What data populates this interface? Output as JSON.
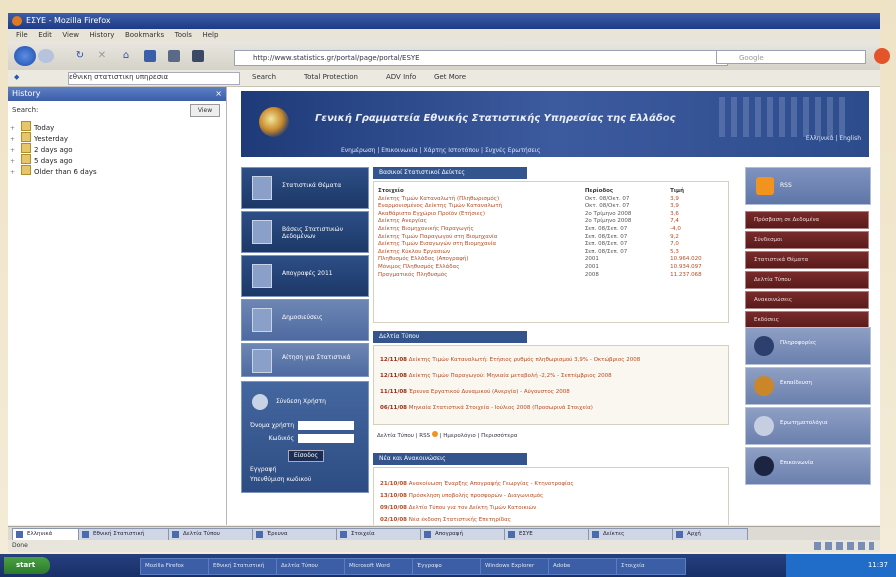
{
  "browser": {
    "title": "ΕΣΥΕ - Mozilla Firefox",
    "menu": [
      "File",
      "Edit",
      "View",
      "History",
      "Bookmarks",
      "Tools",
      "Help"
    ],
    "url": "http://www.statistics.gr/portal/page/portal/ESYE",
    "search_placeholder": "Google",
    "toolbar2": {
      "select_value": "εθνικη στατιστικη υπηρεσια",
      "search_label": "Search",
      "total_protection": "Total Protection",
      "adv_info": "ADV Info",
      "get_more": "Get More"
    }
  },
  "sidebar": {
    "title": "History",
    "search_label": "Search:",
    "view_label": "View",
    "items": [
      "Today",
      "Yesterday",
      "2 days ago",
      "5 days ago",
      "Older than 6 days"
    ]
  },
  "banner": {
    "title": "Γενική Γραμματεία Εθνικής Στατιστικής Υπηρεσίας της Ελλάδος",
    "subtitle": "Ενημέρωση | Επικοινωνία | Χάρτης Ιστοτόπου | Συχνές Ερωτήσεις",
    "right_links": "Ελληνικά | English"
  },
  "left_nav": [
    {
      "label": "Στατιστικά Θέματα"
    },
    {
      "label": "Βάσεις Στατιστικών Δεδομένων"
    },
    {
      "label": "Απογραφές 2011"
    },
    {
      "label": "Δημοσιεύσεις"
    },
    {
      "label": "Αίτηση για Στατιστικά"
    }
  ],
  "login": {
    "title": "Σύνδεση Χρήστη",
    "username_label": "Όνομα χρήστη",
    "password_label": "Κωδικός",
    "submit_label": "Είσοδος",
    "register_link": "Εγγραφή",
    "forgot_link": "Υπενθύμιση κωδικού"
  },
  "panels": {
    "indicators_title": "Βασικοί Στατιστικοί Δείκτες",
    "news_title": "Δελτία Τύπου",
    "announcements_title": "Νέα και Ανακοινώσεις",
    "news_links": [
      "Δελτία Τύπου",
      "RSS",
      "Ημερολόγιο",
      "Περισσότερα"
    ]
  },
  "stats_table": {
    "headers": [
      "Στοιχείο",
      "Περίοδος",
      "Τιμή"
    ],
    "rows": [
      [
        "Δείκτης Τιμών Καταναλωτή (Πληθωρισμός)",
        "Οκτ. 08/Οκτ. 07",
        "3,9"
      ],
      [
        "Εναρμονισμένος Δείκτης Τιμών Καταναλωτή",
        "Οκτ. 08/Οκτ. 07",
        "3,9"
      ],
      [
        "Ακαθάριστο Εγχώριο Προϊόν (Ετήσιες)",
        "2ο Τρίμηνο 2008",
        "3,6"
      ],
      [
        "Δείκτης Ανεργίας",
        "2ο Τρίμηνο 2008",
        "7,4"
      ],
      [
        "Δείκτης Βιομηχανικής Παραγωγής",
        "Σεπ. 08/Σεπ. 07",
        "-4,0"
      ],
      [
        "Δείκτης Τιμών Παραγωγού στη Βιομηχανία",
        "Σεπ. 08/Σεπ. 07",
        "9,2"
      ],
      [
        "Δείκτης Τιμών Εισαγωγών στη Βιομηχανία",
        "Σεπ. 08/Σεπ. 07",
        "7,0"
      ],
      [
        "Δείκτης Κύκλου Εργασιών",
        "Σεπ. 08/Σεπ. 07",
        "5,3"
      ],
      [
        "Πληθυσμός Ελλάδας (Απογραφή)",
        "2001",
        "10.964.020"
      ],
      [
        "Μόνιμος Πληθυσμός Ελλάδας",
        "2001",
        "10.934.097"
      ],
      [
        "Πραγματικός Πληθυσμός",
        "2008",
        "11.237.068"
      ]
    ]
  },
  "news": [
    {
      "date": "12/11/08",
      "text": "Δείκτης Τιμών Καταναλωτή: Ετήσιος ρυθμός πληθωρισμού 3,9% - Οκτώβριος 2008"
    },
    {
      "date": "12/11/08",
      "text": "Δείκτης Τιμών Παραγωγού: Μηνιαία μεταβολή -2,2% - Σεπτέμβριος 2008"
    },
    {
      "date": "11/11/08",
      "text": "Έρευνα Εργατικού Δυναμικού (Ανεργία) - Αύγουστος 2008"
    },
    {
      "date": "06/11/08",
      "text": "Μηνιαία Στατιστικά Στοιχεία - Ιούλιος 2008 (Προσωρινά Στοιχεία)"
    }
  ],
  "announcements": [
    {
      "date": "21/10/08",
      "text": "Ανακοίνωση Έναρξης Απογραφής Γεωργίας - Κτηνοτροφίας"
    },
    {
      "date": "13/10/08",
      "text": "Πρόσκληση υποβολής προσφορών - Διαγωνισμός"
    },
    {
      "date": "09/10/08",
      "text": "Δελτίο Τύπου για τον Δείκτη Τιμών Κατοικιών"
    },
    {
      "date": "02/10/08",
      "text": "Νέα έκδοση Στατιστικής Επετηρίδας"
    }
  ],
  "right_col": {
    "rss_label": "RSS",
    "menu": [
      "Πρόσβαση σε Δεδομένα",
      "Σύνδεσμοι",
      "Στατιστικά Θέματα",
      "Δελτία Τύπου",
      "Ανακοινώσεις",
      "Εκδόσεις"
    ],
    "tiles": [
      "Πληροφορίες",
      "Εκπαίδευση",
      "Ερωτηματολόγια",
      "Επικοινωνία"
    ]
  },
  "tabs": [
    "Ελληνικά",
    "Εθνική Στατιστική",
    "Δελτία Τύπου",
    "Έρευνα",
    "Στοιχεία",
    "Απογραφή",
    "ΕΣΥΕ",
    "Δείκτες",
    "Αρχή"
  ],
  "status": {
    "text": "Done"
  },
  "taskbar": {
    "start_label": "start",
    "buttons": [
      "Mozilla Firefox",
      "Εθνική Στατιστική",
      "Δελτία Τύπου",
      "Microsoft Word",
      "Έγγραφο",
      "Windows Explorer",
      "Adobe",
      "Στοιχεία"
    ],
    "clock": "11:37"
  }
}
